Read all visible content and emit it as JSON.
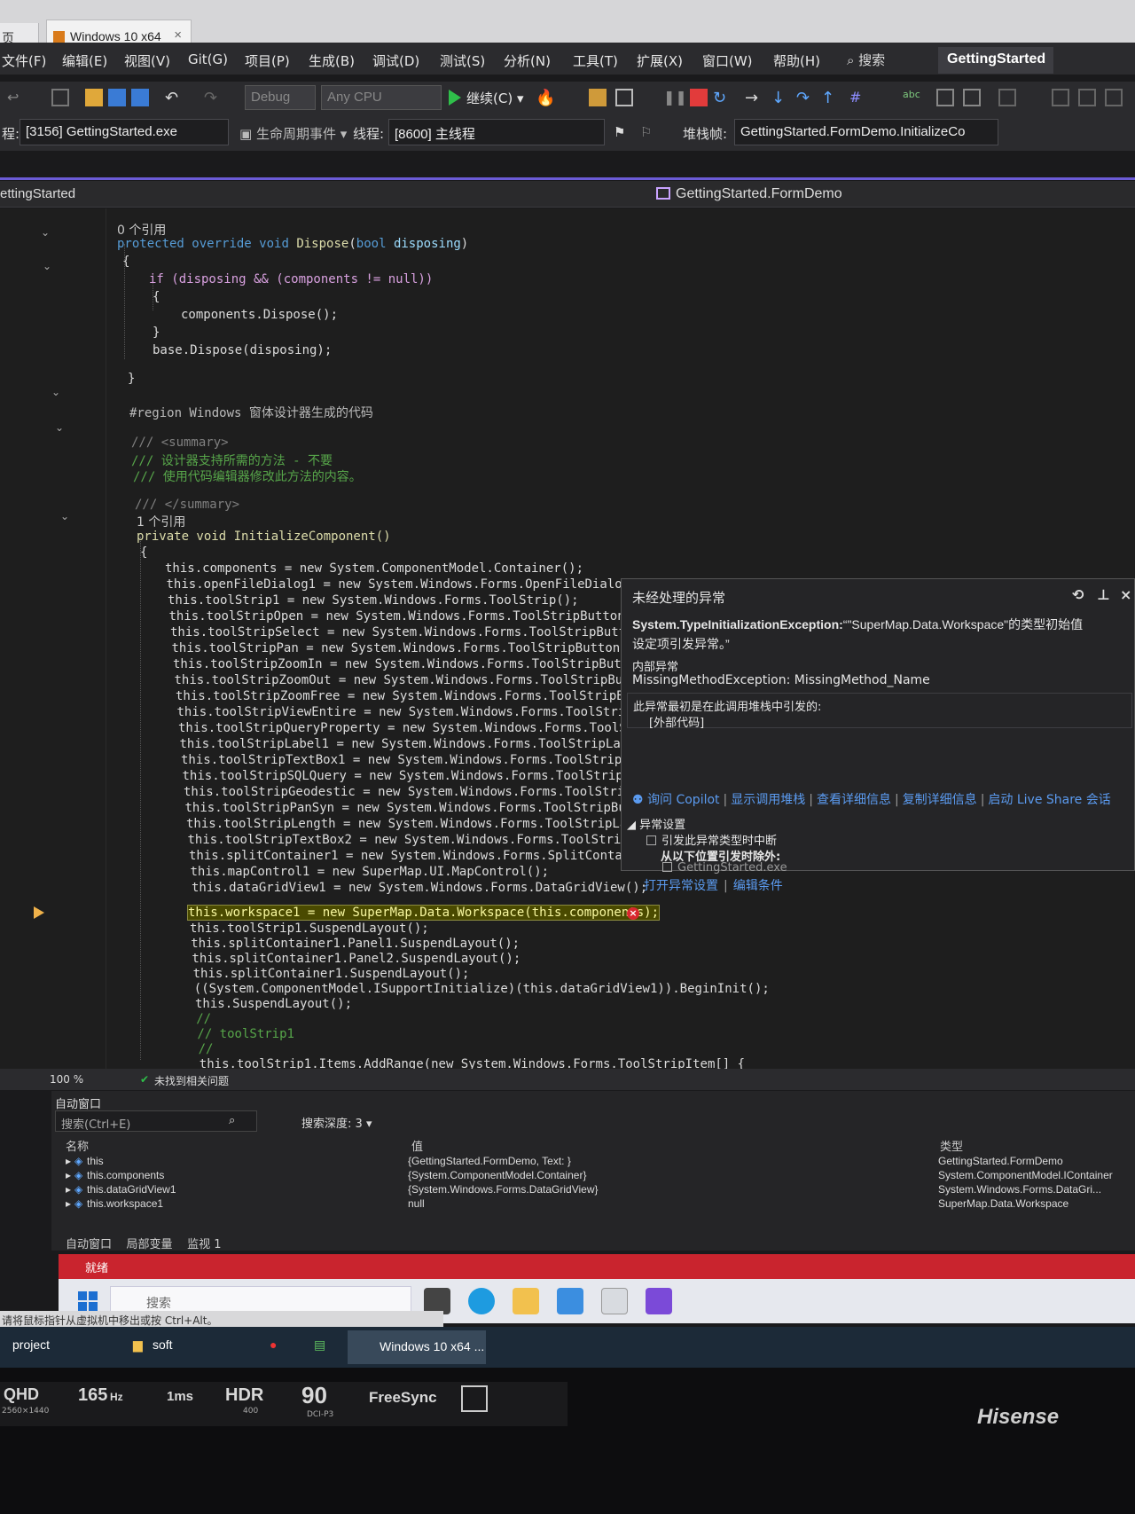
{
  "vm": {
    "prev_tab": "页",
    "tab_title": "Windows 10 x64"
  },
  "menu": [
    "文件(F)",
    "编辑(E)",
    "视图(V)",
    "Git(G)",
    "项目(P)",
    "生成(B)",
    "调试(D)",
    "测试(S)",
    "分析(N)",
    "工具(T)",
    "扩展(X)",
    "窗口(W)",
    "帮助(H)"
  ],
  "search_label": "搜索",
  "solution_title": "GettingStarted",
  "toolbar": {
    "config": "Debug",
    "platform": "Any CPU",
    "continue": "继续(C)"
  },
  "debug_bar": {
    "process_label": "程:",
    "process": "[3156] GettingStarted.exe",
    "lifecycle": "生命周期事件",
    "thread_label": "线程:",
    "thread": "[8600] 主线程",
    "stackframe_label": "堆栈帧:",
    "stackframe": "GettingStarted.FormDemo.InitializeCo"
  },
  "nav": {
    "left": "ettingStarted",
    "right": "GettingStarted.FormDemo"
  },
  "code": {
    "refs0": "0 个引用",
    "dispose_sig": [
      "protected",
      "override",
      "void",
      "Dispose",
      "(",
      "bool",
      "disposing",
      ")"
    ],
    "if_line": "if (disposing && (components != null))",
    "components_dispose": "components.Dispose();",
    "base_dispose": "base.Dispose(disposing);",
    "region": "#region Windows 窗体设计器生成的代码",
    "summary_open": "/// <summary>",
    "summary_l1": "/// 设计器支持所需的方法 - 不要",
    "summary_l2": "/// 使用代码编辑器修改此方法的内容。",
    "summary_close": "/// </summary>",
    "refs1": "1 个引用",
    "init_sig": "private void InitializeComponent()",
    "lines": [
      "this.components = new System.ComponentModel.Container();",
      "this.openFileDialog1 = new System.Windows.Forms.OpenFileDialog()",
      "this.toolStrip1 = new System.Windows.Forms.ToolStrip();",
      "this.toolStripOpen = new System.Windows.Forms.ToolStripButton();",
      "this.toolStripSelect = new System.Windows.Forms.ToolStripButton(",
      "this.toolStripPan = new System.Windows.Forms.ToolStripButton();",
      "this.toolStripZoomIn = new System.Windows.Forms.ToolStripButton(",
      "this.toolStripZoomOut = new System.Windows.Forms.ToolStripButton",
      "this.toolStripZoomFree = new System.Windows.Forms.ToolStripButto",
      "this.toolStripViewEntire = new System.Windows.Forms.ToolStripBut",
      "this.toolStripQueryProperty = new System.Windows.Forms.ToolStrip",
      "this.toolStripLabel1 = new System.Windows.Forms.ToolStripLabel()",
      "this.toolStripTextBox1 = new System.Windows.Forms.ToolStripTextB",
      "this.toolStripSQLQuery = new System.Windows.Forms.ToolStripButto",
      "this.toolStripGeodestic = new System.Windows.Forms.ToolStripButt",
      "this.toolStripPanSyn = new System.Windows.Forms.ToolStripButton(",
      "this.toolStripLength = new System.Windows.Forms.ToolStripLabel()",
      "this.toolStripTextBox2 = new System.Windows.Forms.ToolStripTextB",
      "this.splitContainer1 = new System.Windows.Forms.SplitContainer()",
      "this.mapControl1 = new SuperMap.UI.MapControl();",
      "this.dataGridView1 = new System.Windows.Forms.DataGridView();"
    ],
    "current_line": "this.workspace1 = new SuperMap.Data.Workspace(this.components);",
    "after_lines": [
      "this.toolStrip1.SuspendLayout();",
      "this.splitContainer1.Panel1.SuspendLayout();",
      "this.splitContainer1.Panel2.SuspendLayout();",
      "this.splitContainer1.SuspendLayout();",
      "((System.ComponentModel.ISupportInitialize)(this.dataGridView1)).BeginInit();",
      "this.SuspendLayout();",
      "//",
      "// toolStrip1",
      "//",
      "this.toolStrip1.Items.AddRange(new System.Windows.Forms.ToolStripItem[] {"
    ]
  },
  "exception": {
    "title": "未经处理的异常",
    "type": "System.TypeInitializationException:",
    "message_a": "“\"SuperMap.Data.Workspace\"的类型初始值",
    "message_b": "设定项引发异常。”",
    "inner_label": "内部异常",
    "inner": "MissingMethodException: MissingMethod_Name",
    "origin_label": "此异常最初是在此调用堆栈中引发的:",
    "origin_value": "[外部代码]",
    "links": [
      "询问 Copilot",
      "显示调用堆栈",
      "查看详细信息",
      "复制详细信息",
      "启动 Live Share 会话"
    ],
    "settings_label": "异常设置",
    "break_when": "引发此异常类型时中断",
    "except_from": "从以下位置引发时除外:",
    "module": "GettingStarted.exe",
    "open_settings": "打开异常设置",
    "edit_conditions": "编辑条件"
  },
  "editor_status": {
    "zoom": "100 %",
    "issues": "未找到相关问题"
  },
  "autos": {
    "title": "自动窗口",
    "search_placeholder": "搜索(Ctrl+E)",
    "depth_label": "搜索深度:",
    "depth": "3",
    "col_name": "名称",
    "col_value": "值",
    "col_type": "类型",
    "rows": [
      {
        "name": "this",
        "value": "{GettingStarted.FormDemo, Text: }",
        "type": "GettingStarted.FormDemo"
      },
      {
        "name": "this.components",
        "value": "{System.ComponentModel.Container}",
        "type": "System.ComponentModel.IContainer"
      },
      {
        "name": "this.dataGridView1",
        "value": "{System.Windows.Forms.DataGridView}",
        "type": "System.Windows.Forms.DataGri..."
      },
      {
        "name": "this.workspace1",
        "value": "null",
        "type": "SuperMap.Data.Workspace"
      }
    ],
    "tabs": [
      "自动窗口",
      "局部变量",
      "监视 1"
    ]
  },
  "status_ready": "就绪",
  "guest_taskbar": {
    "search": "搜索"
  },
  "host_hint": "请将鼠标指针从虚拟机中移出或按 Ctrl+Alt。",
  "host_taskbar": {
    "project": "project",
    "soft": "soft",
    "active": "Windows 10 x64 ..."
  },
  "bezel": {
    "qhd": "QHD",
    "res": "2560×1440",
    "hz": "165",
    "hz_unit": "Hz",
    "ms": "1ms",
    "hdr": "HDR",
    "hdr_sub": "400",
    "dci": "90",
    "dci_sub": "DCI-P3",
    "freesync": "FreeSync",
    "brand": "Hisense"
  }
}
